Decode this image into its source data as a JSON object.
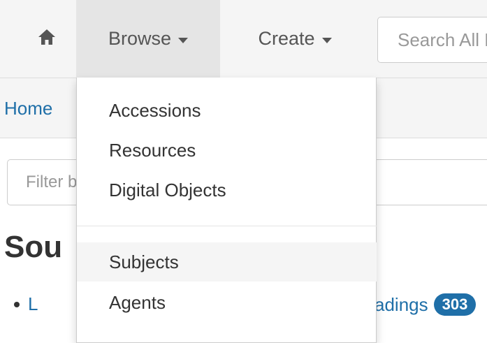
{
  "navbar": {
    "home_icon": "home-icon",
    "browse_label": "Browse",
    "create_label": "Create",
    "search_placeholder": "Search All Records"
  },
  "breadcrumb": {
    "home_label": "Home"
  },
  "filter": {
    "placeholder": "Filter by text"
  },
  "page": {
    "heading": "Sou",
    "list_link_partial": "L",
    "list_tail_text": "adings",
    "list_count": "303"
  },
  "browse_menu": {
    "items": [
      {
        "label": "Accessions"
      },
      {
        "label": "Resources"
      },
      {
        "label": "Digital Objects"
      },
      {
        "label": "Subjects"
      },
      {
        "label": "Agents"
      }
    ],
    "highlighted": "Subjects"
  }
}
